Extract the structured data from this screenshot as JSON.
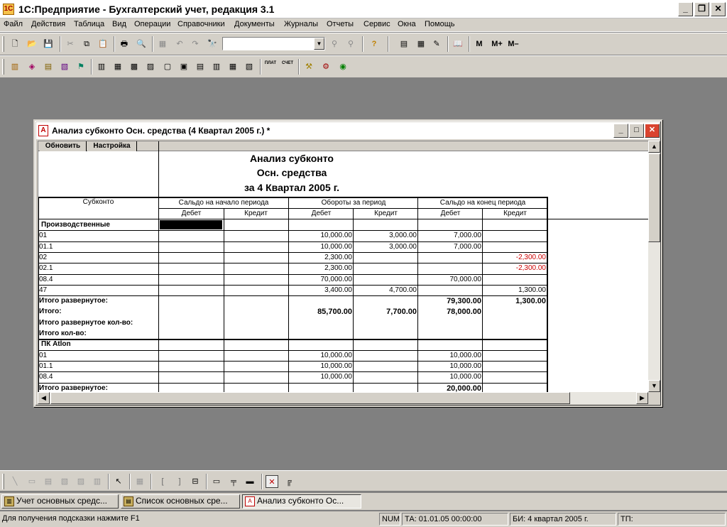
{
  "app": {
    "title": "1С:Предприятие - Бухгалтерский учет, редакция 3.1",
    "icon": "1c-app-icon",
    "window_buttons": {
      "minimize": "_",
      "restore": "❐",
      "close": "✕"
    }
  },
  "menu": [
    "Файл",
    "Действия",
    "Таблица",
    "Вид",
    "Операции",
    "Справочники",
    "Документы",
    "Журналы",
    "Отчеты",
    "Сервис",
    "Окна",
    "Помощь"
  ],
  "toolbar1": {
    "combo_value": "",
    "buttons_text": {
      "m": "M",
      "mplus": "M+",
      "mminus": "M–",
      "help": "?"
    }
  },
  "toolbar2": {
    "plat_label": "ПЛАТ",
    "schet_label": "СЧЕТ"
  },
  "report_window": {
    "title": "Анализ субконто Осн. средства (4 Квартал 2005 г.)  *",
    "refresh_btn": "Обновить",
    "settings_btn": "Настройка",
    "heading1": "Анализ субконто",
    "heading2": "Осн. средства",
    "heading3": "за 4 Квартал 2005 г.",
    "col_subkonto": "Субконто",
    "col_start": "Сальдо на начало периода",
    "col_turnover": "Обороты за период",
    "col_end": "Сальдо на конец периода",
    "debit": "Дебет",
    "credit": "Кредит",
    "rows": [
      {
        "name": "Производственные",
        "bold": true,
        "group": true,
        "vals": [
          "",
          "",
          "",
          "",
          "",
          ""
        ]
      },
      {
        "name": "01",
        "vals": [
          "",
          "",
          "10,000.00",
          "3,000.00",
          "7,000.00",
          ""
        ]
      },
      {
        "name": "01.1",
        "vals": [
          "",
          "",
          "10,000.00",
          "3,000.00",
          "7,000.00",
          ""
        ]
      },
      {
        "name": "02",
        "vals": [
          "",
          "",
          "2,300.00",
          "",
          "",
          "-2,300.00"
        ],
        "neg": 5
      },
      {
        "name": "02.1",
        "vals": [
          "",
          "",
          "2,300.00",
          "",
          "",
          "-2,300.00"
        ],
        "neg": 5
      },
      {
        "name": "08.4",
        "vals": [
          "",
          "",
          "70,000.00",
          "",
          "70,000.00",
          ""
        ]
      },
      {
        "name": "47",
        "vals": [
          "",
          "",
          "3,400.00",
          "4,700.00",
          "",
          "1,300.00"
        ]
      },
      {
        "name": "Итого развернутое:",
        "bold": true,
        "vals": [
          "",
          "",
          "",
          "",
          "79,300.00",
          "1,300.00"
        ]
      },
      {
        "name": "Итого:",
        "bold": true,
        "vals": [
          "",
          "",
          "85,700.00",
          "7,700.00",
          "78,000.00",
          ""
        ]
      },
      {
        "name": "Итого развернутое кол-во:",
        "bold": true,
        "vals": [
          "",
          "",
          "",
          "",
          "",
          ""
        ]
      },
      {
        "name": "Итого кол-во:",
        "bold": true,
        "vals": [
          "",
          "",
          "",
          "",
          "",
          ""
        ]
      },
      {
        "name": "ПК Atlon",
        "bold": true,
        "group": true,
        "vals": [
          "",
          "",
          "",
          "",
          "",
          ""
        ]
      },
      {
        "name": "01",
        "vals": [
          "",
          "",
          "10,000.00",
          "",
          "10,000.00",
          ""
        ]
      },
      {
        "name": "01.1",
        "vals": [
          "",
          "",
          "10,000.00",
          "",
          "10,000.00",
          ""
        ]
      },
      {
        "name": "08.4",
        "vals": [
          "",
          "",
          "10,000.00",
          "",
          "10,000.00",
          ""
        ]
      },
      {
        "name": "Итого развернутое:",
        "bold": true,
        "vals": [
          "",
          "",
          "",
          "",
          "20,000.00",
          ""
        ]
      }
    ],
    "negative_color": "#cc0000"
  },
  "taskbar": [
    {
      "label": "Учет основных средс...",
      "active": false
    },
    {
      "label": "Список основных сре...",
      "active": false
    },
    {
      "label": "Анализ субконто Ос...",
      "active": true
    }
  ],
  "status": {
    "hint": "Для получения подсказки нажмите F1",
    "num": "NUM",
    "ta": "ТА: 01.01.05  00:00:00",
    "bi": "БИ: 4 квартал 2005 г.",
    "tp": "ТП:"
  }
}
